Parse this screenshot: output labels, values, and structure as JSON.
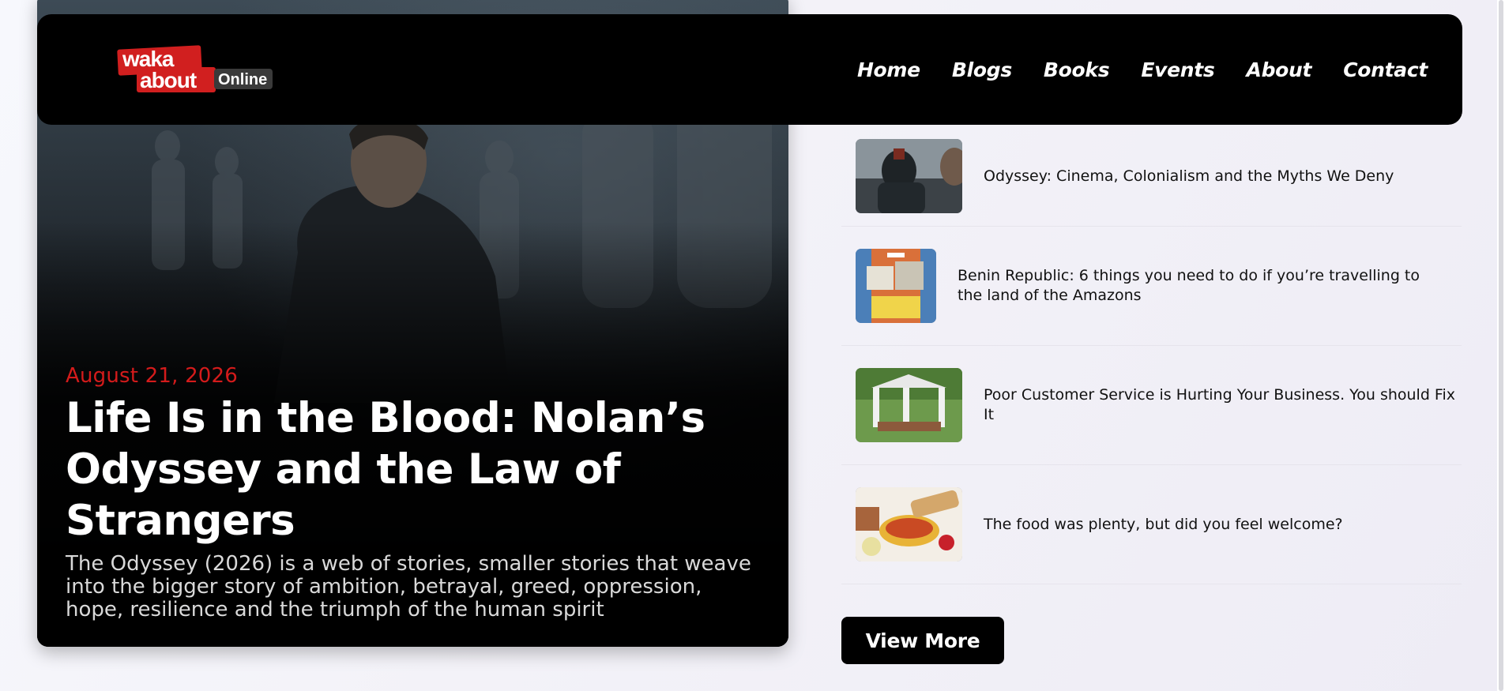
{
  "logo": {
    "top": "waka",
    "bottom": "about",
    "suffix": "Online"
  },
  "nav": [
    {
      "label": "Home"
    },
    {
      "label": "Blogs"
    },
    {
      "label": "Books"
    },
    {
      "label": "Events"
    },
    {
      "label": "About"
    },
    {
      "label": "Contact"
    }
  ],
  "hero": {
    "date": "August 21, 2026",
    "title": "Life Is in the Blood: Nolan’s Odyssey and the Law of Strangers",
    "excerpt": "The Odyssey (2026) is a web of stories, smaller stories that weave into the bigger story of ambition, betrayal, greed, oppression, hope, resilience and the triumph of the human spirit"
  },
  "sidebar": {
    "items": [
      {
        "title": "Odyssey: Cinema, Colonialism and the Myths We Deny"
      },
      {
        "title": "Benin Republic: 6 things you need to do if you’re travelling to the land of the Amazons"
      },
      {
        "title": "Poor Customer Service is Hurting Your Business. You should Fix It"
      },
      {
        "title": "The food was plenty, but did you feel welcome?"
      }
    ],
    "view_more": "View More"
  },
  "colors": {
    "accent_red": "#d41b1b",
    "navbar_bg": "#000000",
    "text_dark": "#111111"
  }
}
